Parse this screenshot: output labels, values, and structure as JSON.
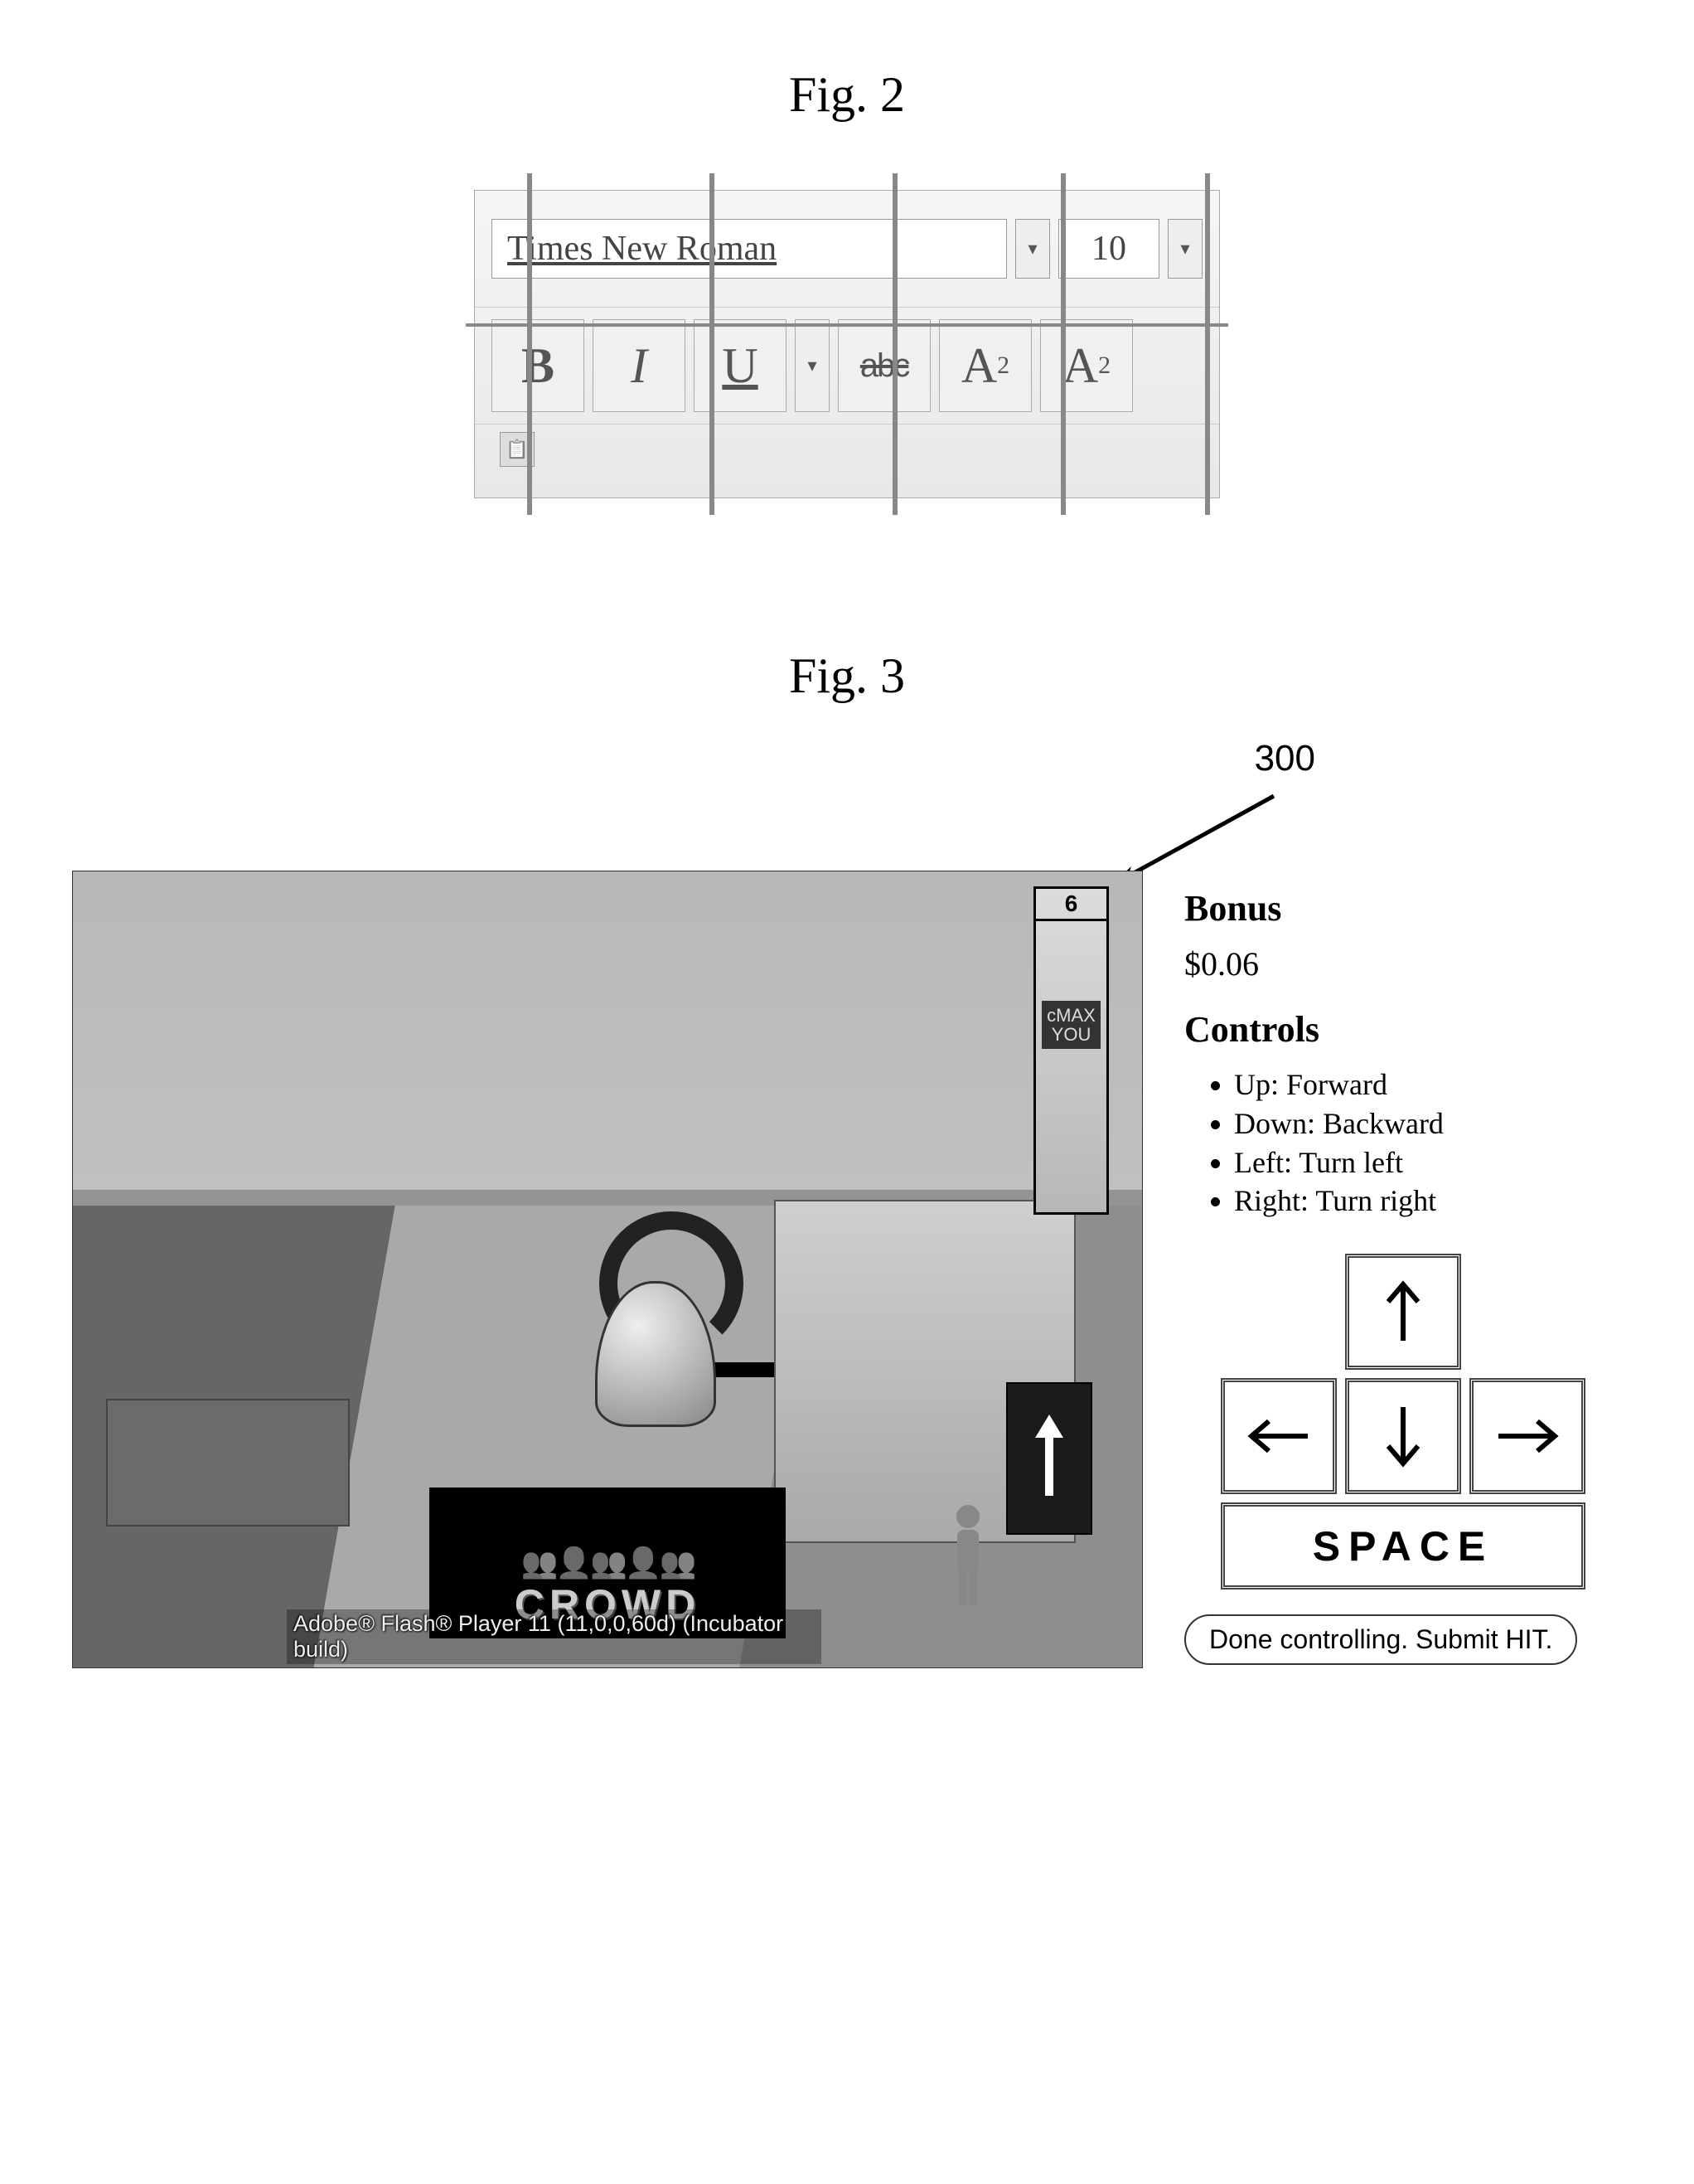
{
  "fig2": {
    "label": "Fig. 2",
    "font_name": "Times New Roman",
    "font_size": "10",
    "buttons": {
      "bold": "B",
      "italic": "I",
      "underline": "U",
      "strike": "abc",
      "superscript_base": "A",
      "superscript_exp": "2",
      "subscript_base": "A",
      "subscript_exp": "2"
    },
    "dropdown_glyph": "▾"
  },
  "fig3": {
    "label": "Fig. 3",
    "reference_number": "300",
    "bonus_heading": "Bonus",
    "bonus_value": "$0.06",
    "controls_heading": "Controls",
    "controls_list": [
      "Up: Forward",
      "Down: Backward",
      "Left: Turn left",
      "Right: Turn right"
    ],
    "space_key_label": "SPACE",
    "submit_label": "Done controlling. Submit HIT.",
    "latency_bar": {
      "top_value": "6",
      "line1": "cMAX",
      "line2": "YOU"
    },
    "crowd_overlay_text": "CROWD",
    "flash_caption": "Adobe® Flash® Player 11 (11,0,0,60d) (Incubator build)"
  }
}
